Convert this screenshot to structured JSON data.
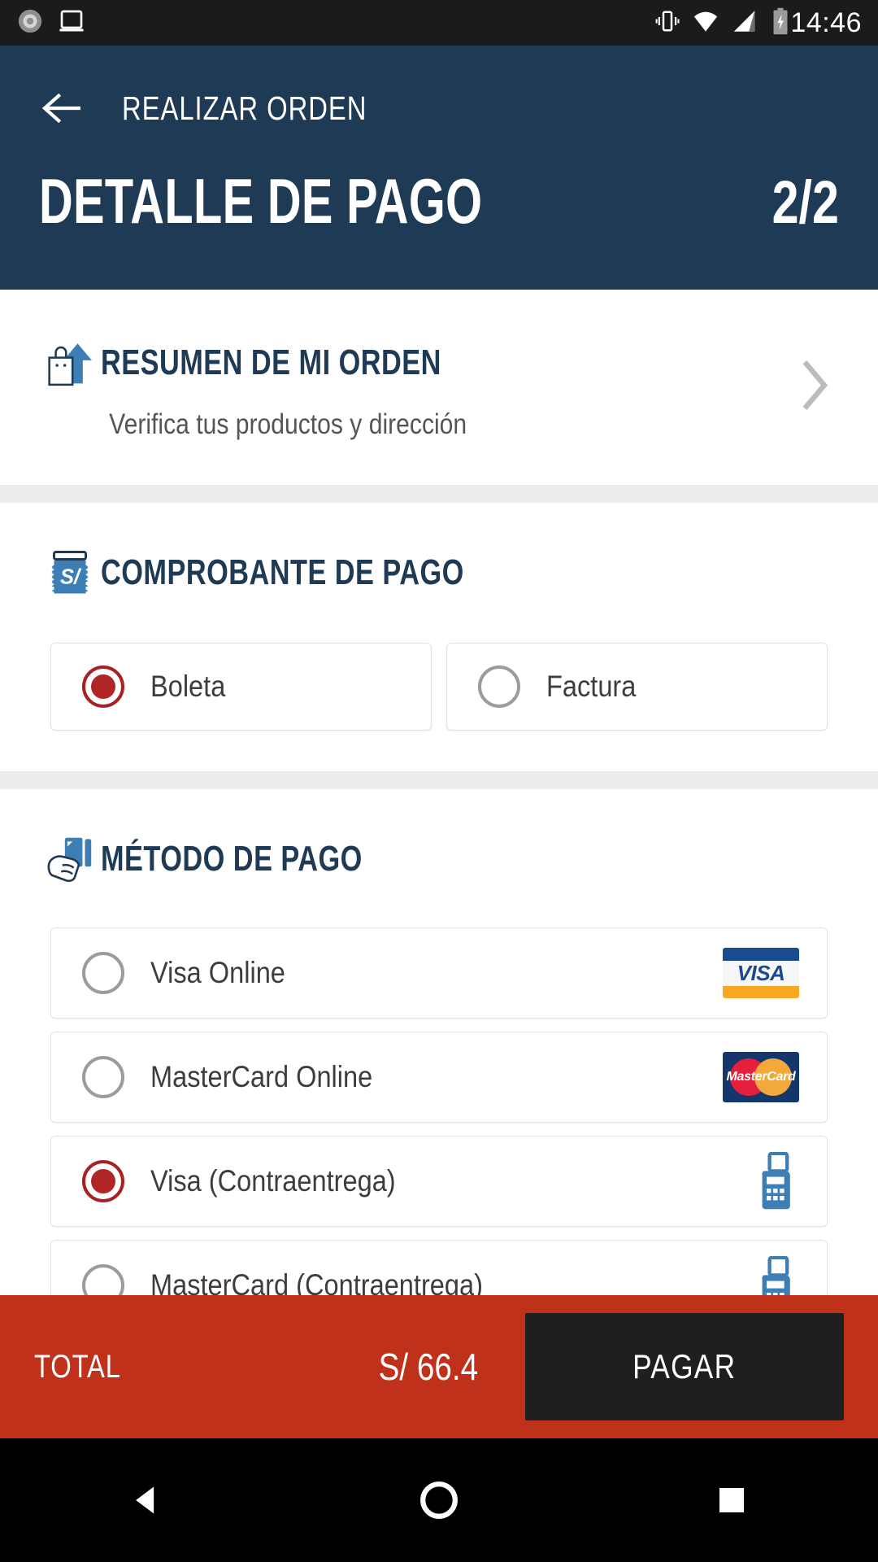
{
  "status_bar": {
    "time": "14:46",
    "icons": [
      "sync-icon",
      "device-icon",
      "vibrate-icon",
      "wifi-icon",
      "signal-icon",
      "battery-charging-icon"
    ]
  },
  "app_bar": {
    "back_icon": "arrow-left-icon",
    "subtitle": "REALIZAR ORDEN",
    "title": "DETALLE DE PAGO",
    "step": "2/2",
    "background_color": "#1f3a55"
  },
  "summary": {
    "icon": "shopping-bag-arrow-icon",
    "title": "RESUMEN DE MI ORDEN",
    "subtitle": "Verifica tus productos y dirección",
    "chevron_icon": "chevron-right-icon"
  },
  "receipt": {
    "icon": "receipt-soles-icon",
    "title": "COMPROBANTE DE PAGO",
    "options": [
      {
        "label": "Boleta",
        "selected": true
      },
      {
        "label": "Factura",
        "selected": false
      }
    ]
  },
  "payment": {
    "icon": "hand-card-icon",
    "title": "MÉTODO DE PAGO",
    "methods": [
      {
        "label": "Visa Online",
        "selected": false,
        "logo": "visa-logo"
      },
      {
        "label": "MasterCard Online",
        "selected": false,
        "logo": "mastercard-logo"
      },
      {
        "label": "Visa (Contraentrega)",
        "selected": true,
        "logo": "pos-terminal-icon"
      },
      {
        "label": "MasterCard (Contraentrega)",
        "selected": false,
        "logo": "pos-terminal-icon"
      }
    ]
  },
  "footer": {
    "total_label": "TOTAL",
    "total_amount": "S/ 66.4",
    "pay_button": "PAGAR",
    "background_color": "#c0311c"
  },
  "nav_bar": {
    "back_icon": "triangle-back-icon",
    "home_icon": "circle-home-icon",
    "recents_icon": "square-recents-icon"
  },
  "colors": {
    "header_blue": "#1f3a55",
    "accent_red": "#b02626",
    "footer_red": "#c0311c",
    "icon_blue": "#3d7fb5"
  }
}
